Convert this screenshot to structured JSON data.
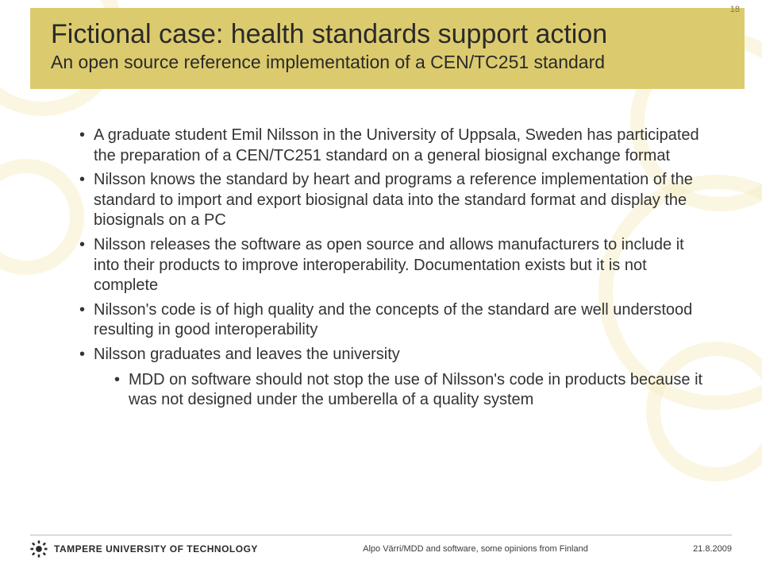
{
  "slide_number": "18",
  "title": "Fictional case: health standards support action",
  "subtitle": "An open source reference implementation of a CEN/TC251 standard",
  "bullets": [
    "A graduate student Emil Nilsson in the University of Uppsala, Sweden has participated the preparation of a CEN/TC251 standard on a general biosignal exchange format",
    "Nilsson knows the standard by heart and programs a reference implementation of the standard to import and export biosignal data into the standard format and display the biosignals on a PC",
    "Nilsson releases the software as open source and allows manufacturers to include it into their products to improve interoperability. Documentation exists but it is not complete",
    "Nilsson's code is of high quality and the concepts of the standard are well understood resulting in good interoperability",
    "Nilsson graduates and leaves the university"
  ],
  "sub_bullet": "MDD on software should not stop the use of Nilsson's code in products because it was not designed under the umberella of a quality system",
  "footer": {
    "org": "TAMPERE UNIVERSITY OF TECHNOLOGY",
    "center": "Alpo Värri/MDD and software, some opinions from Finland",
    "date": "21.8.2009"
  },
  "colors": {
    "title_band": "#DCCB6E",
    "gear": "#f6f0c9"
  }
}
